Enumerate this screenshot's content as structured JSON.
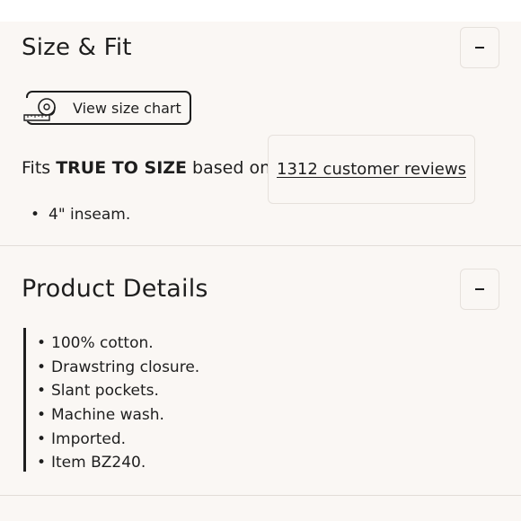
{
  "size_fit": {
    "title": "Size & Fit",
    "toggle_symbol": "−",
    "size_chart_button": {
      "label": "View size chart",
      "icon": "tape-measure-icon"
    },
    "fits": {
      "prefix": "Fits",
      "emphasis": "TRUE TO SIZE",
      "suffix": "based on"
    },
    "reviews_link": "1312 customer reviews",
    "bullets": [
      "4\" inseam."
    ]
  },
  "product_details": {
    "title": "Product Details",
    "toggle_symbol": "−",
    "bullets": [
      "100% cotton.",
      "Drawstring closure.",
      "Slant pockets.",
      "Machine wash.",
      "Imported.",
      "Item BZ240."
    ]
  },
  "colors": {
    "panel_bg": "#faf7f4",
    "text": "#1e1e1e",
    "divider": "#e2ddd8",
    "border": "#e6e1dc"
  }
}
